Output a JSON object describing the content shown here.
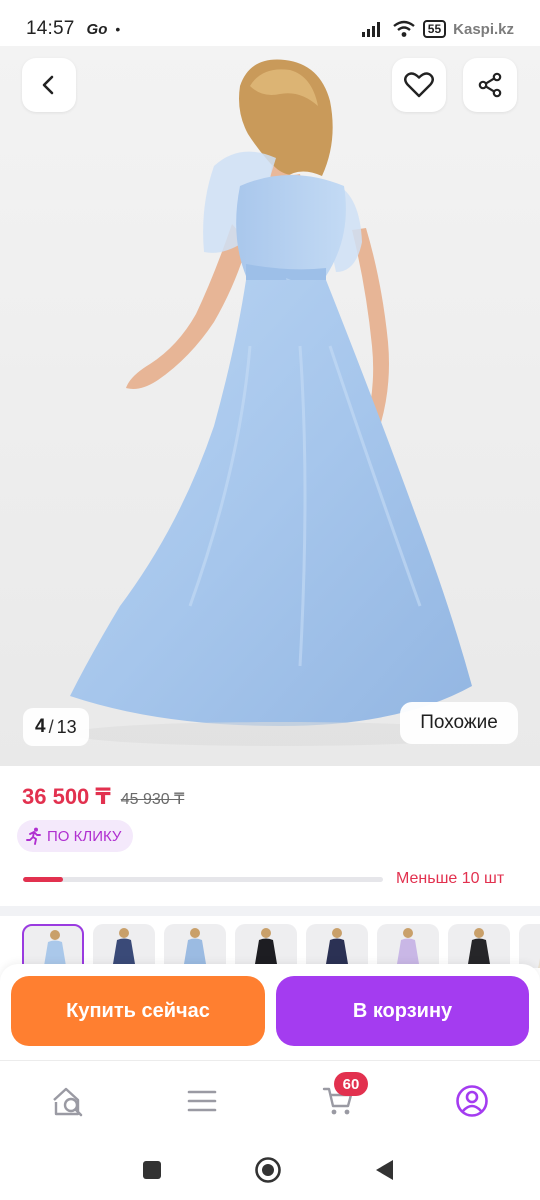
{
  "status_bar": {
    "time": "14:57",
    "app_glyph": "Go",
    "dot": "•",
    "battery": "55",
    "watermark": "Kaspi.kz"
  },
  "hero": {
    "image_counter_current": "4",
    "image_counter_separator": "/",
    "image_counter_total": "13",
    "similar_label": "Похожие",
    "icons": [
      "back-arrow-icon",
      "heart-icon",
      "share-icon"
    ]
  },
  "product": {
    "price": "36 500 ₸",
    "old_price": "45 930 ₸",
    "promo_label": "ПО КЛИКУ",
    "promo_icon": "running-person-icon",
    "stock_label": "Меньше 10 шт",
    "stock_level_percent": 11
  },
  "variants": [
    {
      "name": "light-blue",
      "color": "#aac8ea",
      "selected": true
    },
    {
      "name": "navy-print",
      "color": "#3a4a78",
      "selected": false
    },
    {
      "name": "blue",
      "color": "#9bbbe2",
      "selected": false
    },
    {
      "name": "black",
      "color": "#1d1d22",
      "selected": false
    },
    {
      "name": "navy",
      "color": "#2b3154",
      "selected": false
    },
    {
      "name": "lavender",
      "color": "#c9b7e6",
      "selected": false
    },
    {
      "name": "black-lace",
      "color": "#262629",
      "selected": false
    },
    {
      "name": "cream",
      "color": "#e9dfcf",
      "selected": false
    }
  ],
  "actions": {
    "buy_now_label": "Купить сейчас",
    "add_to_cart_label": "В корзину"
  },
  "bottom_nav": {
    "items": [
      "home-search-icon",
      "catalog-icon",
      "cart-icon",
      "profile-icon"
    ],
    "cart_count": "60",
    "accent": "#a43cf0"
  },
  "colors": {
    "price": "#e2314f",
    "buy_button": "#ff7f30",
    "cart_button": "#a43cf0",
    "promo_text": "#b02fd0"
  }
}
